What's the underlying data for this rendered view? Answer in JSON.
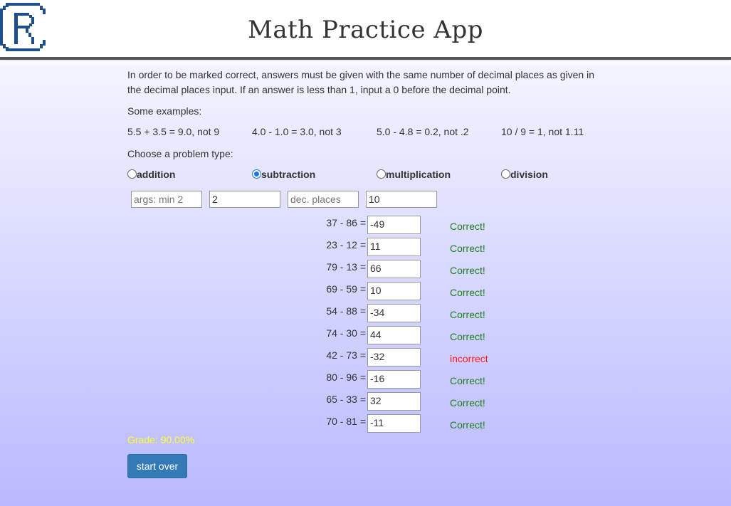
{
  "header": {
    "title": "Math Practice App",
    "logo_letter": "R"
  },
  "instructions": {
    "line1": "In order to be marked correct, answers must be given with the same number of decimal places as given in",
    "line2": "the decimal places input. If an answer is less than 1, input a 0 before the decimal point.",
    "examples_label": "Some examples:",
    "examples": [
      "5.5 + 3.5 = 9.0, not 9",
      "4.0 - 1.0 = 3.0, not 3",
      "5.0 - 4.8 = 0.2, not .2",
      "10 / 9 = 1, not 1.11"
    ],
    "choose_label": "Choose a problem type:"
  },
  "problem_types": [
    {
      "label": "addition",
      "checked": false
    },
    {
      "label": "subtraction",
      "checked": true
    },
    {
      "label": "multiplication",
      "checked": false
    },
    {
      "label": "division",
      "checked": false
    }
  ],
  "settings": {
    "args_placeholder": "args: min 2",
    "args_value": "2",
    "dec_placeholder": "dec. places",
    "dec_value": "10"
  },
  "problems": [
    {
      "question": "37 - 86 =",
      "answer": "-49",
      "result": "Correct!"
    },
    {
      "question": "23 - 12 =",
      "answer": "11",
      "result": "Correct!"
    },
    {
      "question": "79 - 13 =",
      "answer": "66",
      "result": "Correct!"
    },
    {
      "question": "69 - 59 =",
      "answer": "10",
      "result": "Correct!"
    },
    {
      "question": "54 - 88 =",
      "answer": "-34",
      "result": "Correct!"
    },
    {
      "question": "74 - 30 =",
      "answer": "44",
      "result": "Correct!"
    },
    {
      "question": "42 - 73 =",
      "answer": "-32",
      "result": "incorrect"
    },
    {
      "question": "80 - 96 =",
      "answer": "-16",
      "result": "Correct!"
    },
    {
      "question": "65 - 33 =",
      "answer": "32",
      "result": "Correct!"
    },
    {
      "question": "70 - 81 =",
      "answer": "-11",
      "result": "Correct!"
    }
  ],
  "grade": "Grade: 90.00%",
  "start_over_label": "start over",
  "colors": {
    "correct": "#1e7d1e",
    "incorrect": "#ff1a1a",
    "grade": "#ffff33",
    "button": "#337ab7",
    "logo": "#1f4e8c"
  }
}
